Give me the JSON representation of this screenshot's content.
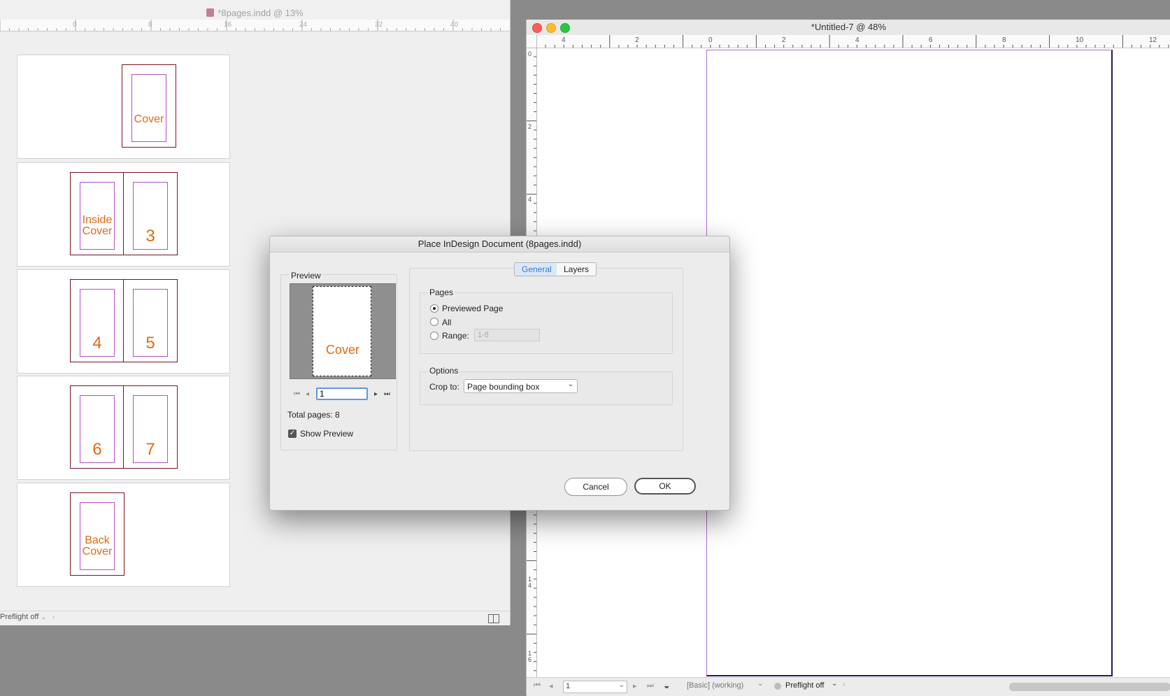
{
  "left_window": {
    "title": "*8pages.indd @ 13%",
    "ruler_labels": [
      "0",
      "8",
      "16",
      "24",
      "32",
      "40"
    ],
    "spreads": [
      {
        "pages": [
          {
            "label": "Cover"
          }
        ]
      },
      {
        "pages": [
          {
            "label": "Inside\nCover"
          },
          {
            "label": "3"
          }
        ]
      },
      {
        "pages": [
          {
            "label": "4"
          },
          {
            "label": "5"
          }
        ]
      },
      {
        "pages": [
          {
            "label": "6"
          },
          {
            "label": "7"
          }
        ]
      },
      {
        "pages": [
          {
            "label": "Back\nCover"
          }
        ]
      }
    ],
    "status": {
      "preflight": "Preflight off"
    }
  },
  "right_window": {
    "title": "*Untitled-7 @ 48%",
    "h_ruler_labels": [
      "4",
      "2",
      "0",
      "2",
      "4",
      "6",
      "8",
      "10",
      "12"
    ],
    "v_ruler_labels": [
      "0",
      "2",
      "4",
      "1\n4",
      "1\n6"
    ],
    "status": {
      "page_number": "1",
      "style": "[Basic] (working)",
      "preflight": "Preflight off"
    }
  },
  "dialog": {
    "title": "Place InDesign Document (8pages.indd)",
    "preview": {
      "section_label": "Preview",
      "page_label": "Cover",
      "page_input": "1",
      "total_pages": "Total pages: 8",
      "show_preview_label": "Show Preview",
      "show_preview_checked": true
    },
    "tabs": [
      {
        "label": "General",
        "active": true
      },
      {
        "label": "Layers",
        "active": false
      }
    ],
    "pages": {
      "section_label": "Pages",
      "options": [
        {
          "label": "Previewed Page",
          "selected": true
        },
        {
          "label": "All",
          "selected": false
        },
        {
          "label": "Range:",
          "selected": false
        }
      ],
      "range_value": "1-8"
    },
    "options": {
      "section_label": "Options",
      "crop_label": "Crop to:",
      "crop_value": "Page bounding box"
    },
    "buttons": {
      "cancel": "Cancel",
      "ok": "OK"
    },
    "colors": {
      "accent": "#2d7cd6",
      "page_label": "#e06a12"
    }
  }
}
